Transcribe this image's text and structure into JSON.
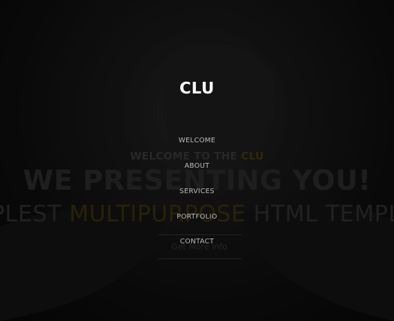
{
  "brand": {
    "name": "CLU"
  },
  "menu": {
    "items": [
      {
        "label": "WELCOME"
      },
      {
        "label": "ABOUT"
      },
      {
        "label": "SERVICES"
      },
      {
        "label": "PORTFOLIO"
      },
      {
        "label": "CONTACT"
      }
    ]
  },
  "hero": {
    "kicker_prefix": "WELCOME TO THE ",
    "kicker_accent": "CLU",
    "title": "WE PRESENTING YOU!",
    "subtitle_prefix": "SIMPLEST ",
    "subtitle_accent": "MULTIPURPOSE",
    "subtitle_suffix": " HTML TEMPLATE",
    "cta_label": "Get More Info"
  },
  "colors": {
    "accent": "#c9a227",
    "menu_text": "#bdbdbd",
    "brand_text": "#ffffff"
  }
}
